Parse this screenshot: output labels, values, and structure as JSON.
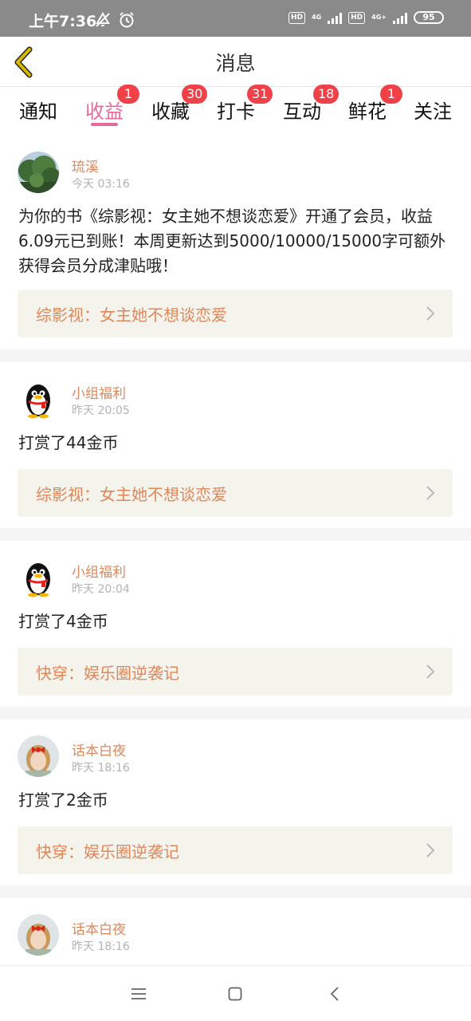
{
  "status_bar": {
    "time": "上午7:36",
    "hd1": "HD",
    "net1": "4G",
    "hd2": "HD",
    "net2": "4G+",
    "battery": "95",
    "icons": [
      "mute-alarm-icon",
      "alarm-clock-icon",
      "signal-icon",
      "battery-icon"
    ]
  },
  "header": {
    "title": "消息",
    "back_icon": "chevron-left-icon"
  },
  "tabs": [
    {
      "label": "通知",
      "badge": ""
    },
    {
      "label": "收益",
      "badge": "1",
      "active": true
    },
    {
      "label": "收藏",
      "badge": "30"
    },
    {
      "label": "打卡",
      "badge": "31"
    },
    {
      "label": "互动",
      "badge": "18"
    },
    {
      "label": "鲜花",
      "badge": "1"
    },
    {
      "label": "关注",
      "badge": ""
    }
  ],
  "feed": [
    {
      "user": "琉溪",
      "time": "今天 03:16",
      "avatar": "landscape-tree-avatar",
      "message": "为你的书《综影视：女主她不想谈恋爱》开通了会员，收益6.09元已到账！本周更新达到5000/10000/15000字可额外获得会员分成津贴哦！",
      "book": "综影视：女主她不想谈恋爱"
    },
    {
      "user": "小组福利",
      "time": "昨天 20:05",
      "avatar": "penguin-avatar",
      "message": "打赏了44金币",
      "book": "综影视：女主她不想谈恋爱"
    },
    {
      "user": "小组福利",
      "time": "昨天 20:04",
      "avatar": "penguin-avatar",
      "message": "打赏了4金币",
      "book": "快穿：娱乐圈逆袭记"
    },
    {
      "user": "话本白夜",
      "time": "昨天 18:16",
      "avatar": "girl-avatar",
      "message": "打赏了2金币",
      "book": "快穿：娱乐圈逆袭记"
    },
    {
      "user": "话本白夜",
      "time": "昨天 18:16",
      "avatar": "girl-avatar",
      "message": "",
      "book": ""
    }
  ],
  "colors": {
    "accent": "#e56a9a",
    "name": "#e0875a",
    "badge": "#f04149",
    "book_bg": "#f4f3ec",
    "back_arrow": "#d4b400"
  },
  "navbar": {
    "icons": [
      "menu-icon",
      "home-square-icon",
      "back-triangle-icon"
    ]
  }
}
